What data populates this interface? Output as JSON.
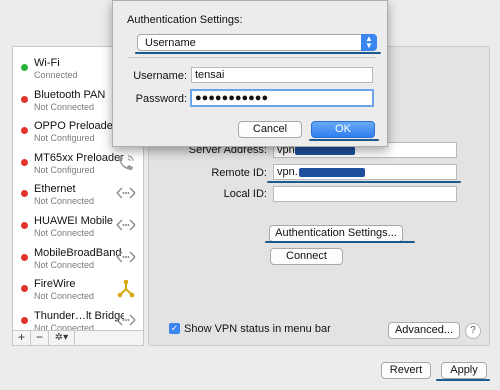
{
  "services": [
    {
      "name": "Wi-Fi",
      "status": "Connected",
      "dot": "#29b43c",
      "icon": "none"
    },
    {
      "name": "Bluetooth PAN",
      "status": "Not Connected",
      "dot": "#e0332b",
      "icon": "none"
    },
    {
      "name": "OPPO Preloader",
      "status": "Not Configured",
      "dot": "#e0332b",
      "icon": "none"
    },
    {
      "name": "MT65xx Preloader",
      "status": "Not Configured",
      "dot": "#e0332b",
      "icon": "phone-icon"
    },
    {
      "name": "Ethernet",
      "status": "Not Connected",
      "dot": "#e0332b",
      "icon": "network-arrows-icon"
    },
    {
      "name": "HUAWEI Mobile",
      "status": "Not Connected",
      "dot": "#e0332b",
      "icon": "network-arrows-icon"
    },
    {
      "name": "MobileBroadBand",
      "status": "Not Connected",
      "dot": "#e0332b",
      "icon": "network-arrows-icon"
    },
    {
      "name": "FireWire",
      "status": "Not Connected",
      "dot": "#e0332b",
      "icon": "firewire-icon"
    },
    {
      "name": "Thunder…lt Bridge",
      "status": "Not Connected",
      "dot": "#e0332b",
      "icon": "network-arrows-icon"
    }
  ],
  "sidebar_footer": {
    "add": "+",
    "remove": "−",
    "gear": "✲▾"
  },
  "vpn": {
    "server_address_label": "Server Address:",
    "server_address_value": "vpn.",
    "remote_id_label": "Remote ID:",
    "remote_id_value": "vpn.",
    "local_id_label": "Local ID:",
    "local_id_value": "",
    "auth_settings_button": "Authentication Settings...",
    "connect_button": "Connect",
    "show_status_label": "Show VPN status in menu bar",
    "show_status_checked": true,
    "advanced_button": "Advanced...",
    "help": "?"
  },
  "footer": {
    "revert_button": "Revert",
    "apply_button": "Apply"
  },
  "sheet": {
    "title": "Authentication Settings:",
    "method": "Username",
    "username_label": "Username:",
    "username_value": "tensai",
    "password_label": "Password:",
    "password_value": "●●●●●●●●●●●",
    "cancel_button": "Cancel",
    "ok_button": "OK"
  },
  "colors": {
    "accent": "#3a86f0",
    "annotation": "#1b5a8c",
    "connected": "#29b43c",
    "disconnected": "#e0332b"
  }
}
